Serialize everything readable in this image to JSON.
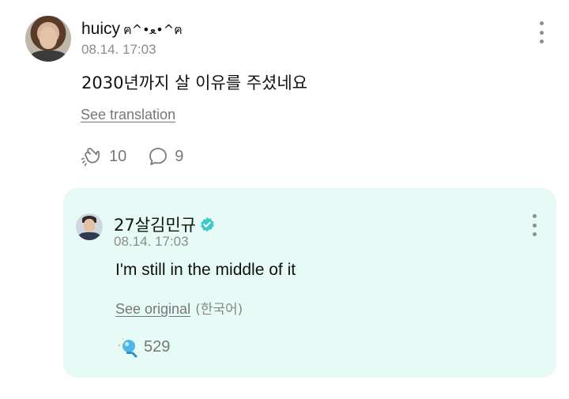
{
  "post": {
    "username": "huicy",
    "username_deco": "ฅ^•ﻌ•^ฅ",
    "timestamp": "08.14. 17:03",
    "content": "2030년까지 살 이유를 주셨네요",
    "see_translation": "See translation",
    "likes": "10",
    "comments": "9",
    "icons": {
      "like": "hand-wave-icon",
      "comment": "speech-bubble-icon",
      "more": "kebab-menu-icon"
    }
  },
  "reply": {
    "username": "27살김민규",
    "verified": true,
    "timestamp": "08.14. 17:03",
    "content": "I'm still in the middle of it",
    "see_original": "See original",
    "original_language": "(한국어)",
    "likes": "529",
    "colors": {
      "card_background": "#e6fbf6",
      "verified_badge": "#3cc9c9"
    },
    "icons": {
      "like": "sparkle-lightbulb-icon",
      "more": "kebab-menu-icon",
      "verified": "verified-badge-icon"
    }
  }
}
